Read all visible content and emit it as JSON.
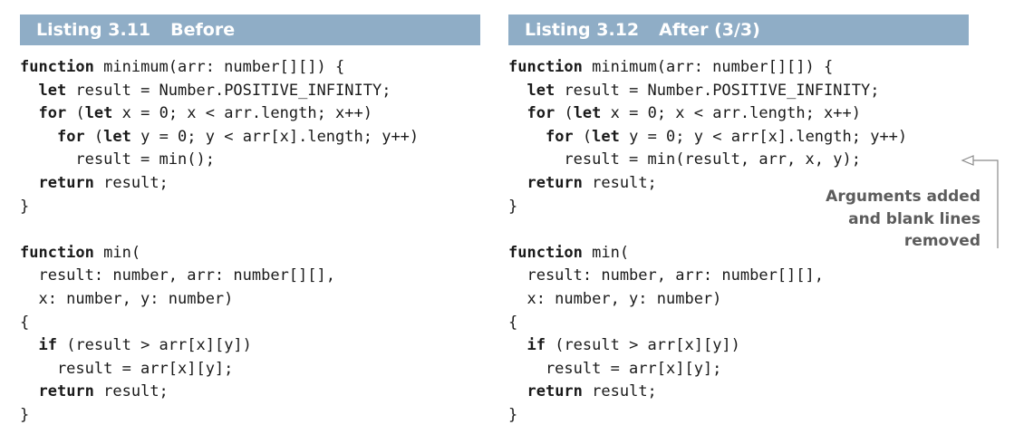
{
  "listings": [
    {
      "number": "Listing 3.11",
      "title": "Before",
      "lines": [
        [
          {
            "t": "function",
            "k": true
          },
          {
            "t": " minimum(arr: number[][]) {"
          }
        ],
        [
          {
            "t": "  "
          },
          {
            "t": "let",
            "k": true
          },
          {
            "t": " result = Number.POSITIVE_INFINITY;"
          }
        ],
        [
          {
            "t": "  "
          },
          {
            "t": "for",
            "k": true
          },
          {
            "t": " ("
          },
          {
            "t": "let",
            "k": true
          },
          {
            "t": " x = 0; x < arr.length; x++)"
          }
        ],
        [
          {
            "t": "    "
          },
          {
            "t": "for",
            "k": true
          },
          {
            "t": " ("
          },
          {
            "t": "let",
            "k": true
          },
          {
            "t": " y = 0; y < arr[x].length; y++)"
          }
        ],
        [
          {
            "t": "      result = min();"
          }
        ],
        [
          {
            "t": "  "
          },
          {
            "t": "return",
            "k": true
          },
          {
            "t": " result;"
          }
        ],
        [
          {
            "t": "}"
          }
        ],
        [
          {
            "t": ""
          }
        ],
        [
          {
            "t": "function",
            "k": true
          },
          {
            "t": " min("
          }
        ],
        [
          {
            "t": "  result: number, arr: number[][],"
          }
        ],
        [
          {
            "t": "  x: number, y: number)"
          }
        ],
        [
          {
            "t": "{"
          }
        ],
        [
          {
            "t": "  "
          },
          {
            "t": "if",
            "k": true
          },
          {
            "t": " (result > arr[x][y])"
          }
        ],
        [
          {
            "t": "    result = arr[x][y];"
          }
        ],
        [
          {
            "t": "  "
          },
          {
            "t": "return",
            "k": true
          },
          {
            "t": " result;"
          }
        ],
        [
          {
            "t": "}"
          }
        ]
      ]
    },
    {
      "number": "Listing 3.12",
      "title": "After (3/3)",
      "lines": [
        [
          {
            "t": "function",
            "k": true
          },
          {
            "t": " minimum(arr: number[][]) {"
          }
        ],
        [
          {
            "t": "  "
          },
          {
            "t": "let",
            "k": true
          },
          {
            "t": " result = Number.POSITIVE_INFINITY;"
          }
        ],
        [
          {
            "t": "  "
          },
          {
            "t": "for",
            "k": true
          },
          {
            "t": " ("
          },
          {
            "t": "let",
            "k": true
          },
          {
            "t": " x = 0; x < arr.length; x++)"
          }
        ],
        [
          {
            "t": "    "
          },
          {
            "t": "for",
            "k": true
          },
          {
            "t": " ("
          },
          {
            "t": "let",
            "k": true
          },
          {
            "t": " y = 0; y < arr[x].length; y++)"
          }
        ],
        [
          {
            "t": "      result = min(result, arr, x, y);"
          }
        ],
        [
          {
            "t": "  "
          },
          {
            "t": "return",
            "k": true
          },
          {
            "t": " result;"
          }
        ],
        [
          {
            "t": "}"
          }
        ],
        [
          {
            "t": ""
          }
        ],
        [
          {
            "t": "function",
            "k": true
          },
          {
            "t": " min("
          }
        ],
        [
          {
            "t": "  result: number, arr: number[][],"
          }
        ],
        [
          {
            "t": "  x: number, y: number)"
          }
        ],
        [
          {
            "t": "{"
          }
        ],
        [
          {
            "t": "  "
          },
          {
            "t": "if",
            "k": true
          },
          {
            "t": " (result > arr[x][y])"
          }
        ],
        [
          {
            "t": "    result = arr[x][y];"
          }
        ],
        [
          {
            "t": "  "
          },
          {
            "t": "return",
            "k": true
          },
          {
            "t": " result;"
          }
        ],
        [
          {
            "t": "}"
          }
        ]
      ]
    }
  ],
  "callout": {
    "lines": [
      "Arguments added",
      "and blank lines",
      "removed"
    ]
  },
  "colors": {
    "header_bg": "#8fadc6",
    "header_text": "#ffffff",
    "code_text": "#1a1a1a",
    "callout_text": "#5c5c5c"
  }
}
